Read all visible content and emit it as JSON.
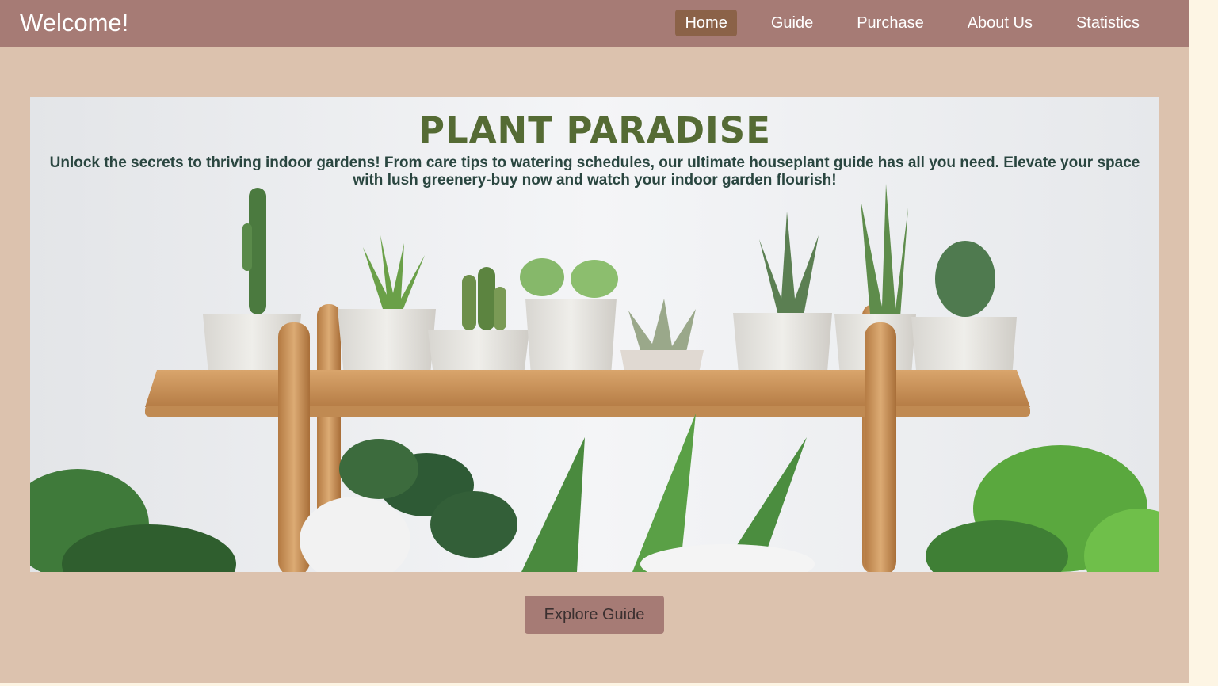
{
  "header": {
    "brand": "Welcome!",
    "nav": [
      {
        "label": "Home",
        "active": true
      },
      {
        "label": "Guide",
        "active": false
      },
      {
        "label": "Purchase",
        "active": false
      },
      {
        "label": "About Us",
        "active": false
      },
      {
        "label": "Statistics",
        "active": false
      }
    ]
  },
  "hero": {
    "title": "PLANT PARADISE",
    "description": "Unlock the secrets to thriving indoor gardens! From care tips to watering schedules, our ultimate houseplant guide has all you need. Elevate your space with lush greenery-buy now and watch your indoor garden flourish!"
  },
  "cta": {
    "label": "Explore Guide"
  },
  "colors": {
    "navbar": "#a67b75",
    "page_background": "#dcc2ae",
    "active_nav": "#8b6248",
    "title": "#556b34",
    "button": "#a67b75"
  }
}
